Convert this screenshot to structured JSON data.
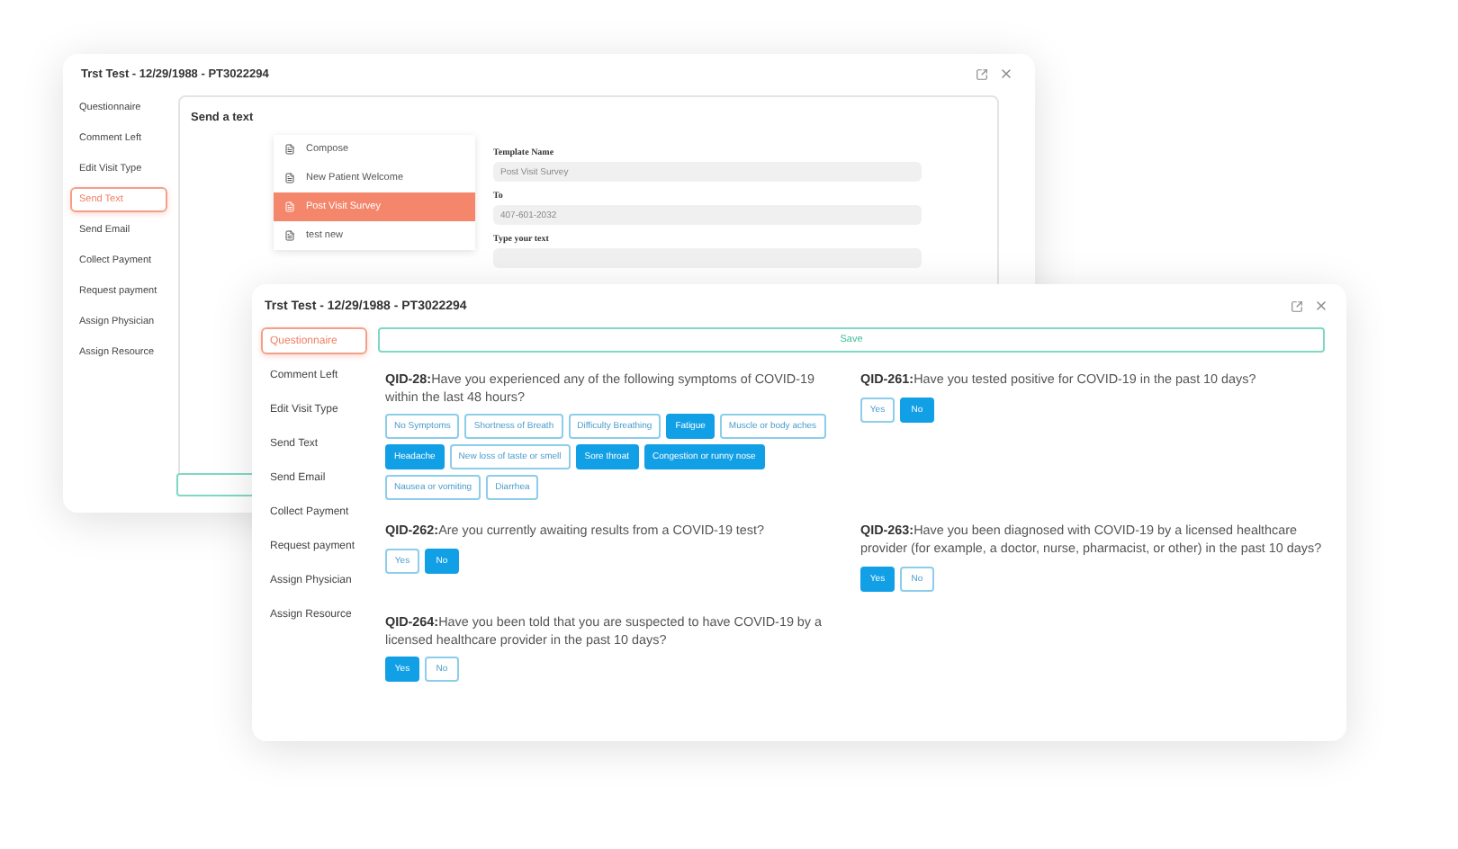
{
  "back_window": {
    "title": "Trst Test - 12/29/1988 - PT3022294",
    "sidebar": [
      {
        "label": "Questionnaire",
        "selected": false
      },
      {
        "label": "Comment Left",
        "selected": false
      },
      {
        "label": "Edit Visit Type",
        "selected": false
      },
      {
        "label": "Send Text",
        "selected": true
      },
      {
        "label": "Send Email",
        "selected": false
      },
      {
        "label": "Collect Payment",
        "selected": false
      },
      {
        "label": "Request payment",
        "selected": false
      },
      {
        "label": "Assign Physician",
        "selected": false
      },
      {
        "label": "Assign Resource",
        "selected": false
      }
    ],
    "panel": {
      "title": "Send a text",
      "templates": [
        {
          "label": "Compose",
          "selected": false
        },
        {
          "label": "New Patient Welcome",
          "selected": false
        },
        {
          "label": "Post Visit Survey",
          "selected": true
        },
        {
          "label": "test new",
          "selected": false
        }
      ],
      "fields": [
        {
          "label": "Template Name",
          "value": "Post Visit Survey"
        },
        {
          "label": "To",
          "value": "407-601-2032"
        },
        {
          "label": "Type your text"
        }
      ]
    }
  },
  "front_window": {
    "title": "Trst Test - 12/29/1988 - PT3022294",
    "sidebar": [
      {
        "label": "Questionnaire",
        "selected": true
      },
      {
        "label": "Comment Left",
        "selected": false
      },
      {
        "label": "Edit Visit Type",
        "selected": false
      },
      {
        "label": "Send Text",
        "selected": false
      },
      {
        "label": "Send Email",
        "selected": false
      },
      {
        "label": "Collect Payment",
        "selected": false
      },
      {
        "label": "Request payment",
        "selected": false
      },
      {
        "label": "Assign Physician",
        "selected": false
      },
      {
        "label": "Assign Resource",
        "selected": false
      }
    ],
    "save_button": "Save",
    "questions": [
      {
        "text": "**QID-28:**Have you experienced any of the following symptoms of COVID-19 within the last 48 hours?",
        "options": [
          {
            "label": "No Symptoms",
            "selected": false
          },
          {
            "label": "Shortness of Breath",
            "selected": false
          },
          {
            "label": "Difficulty Breathing",
            "selected": false
          },
          {
            "label": "Fatigue",
            "selected": true
          },
          {
            "label": "Muscle or body aches",
            "selected": false
          },
          {
            "label": "Headache",
            "selected": true
          },
          {
            "label": "New loss of taste or smell",
            "selected": false
          },
          {
            "label": "Sore throat",
            "selected": true
          },
          {
            "label": "Congestion or runny nose",
            "selected": true
          },
          {
            "label": "Nausea or vomiting",
            "selected": false
          },
          {
            "label": "Diarrhea",
            "selected": false
          }
        ]
      },
      {
        "text": "**QID-261:**Have you tested positive for COVID-19 in the past 10 days?",
        "options": [
          {
            "label": "Yes",
            "selected": false
          },
          {
            "label": "No",
            "selected": true
          }
        ]
      },
      {
        "text": "**QID-262:**Are you currently awaiting results from a COVID-19 test?",
        "options": [
          {
            "label": "Yes",
            "selected": false
          },
          {
            "label": "No",
            "selected": true
          }
        ]
      },
      {
        "text": "**QID-263:**Have you been diagnosed with COVID-19 by a licensed healthcare provider (for example, a doctor, nurse, pharmacist, or other) in the past 10 days?",
        "options": [
          {
            "label": "Yes",
            "selected": true
          },
          {
            "label": "No",
            "selected": false
          }
        ]
      },
      {
        "text": "**QID-264:**Have you been told that you are suspected to have COVID-19 by a licensed healthcare provider in the past 10 days?",
        "options": [
          {
            "label": "Yes",
            "selected": true
          },
          {
            "label": "No",
            "selected": false
          }
        ]
      }
    ]
  }
}
